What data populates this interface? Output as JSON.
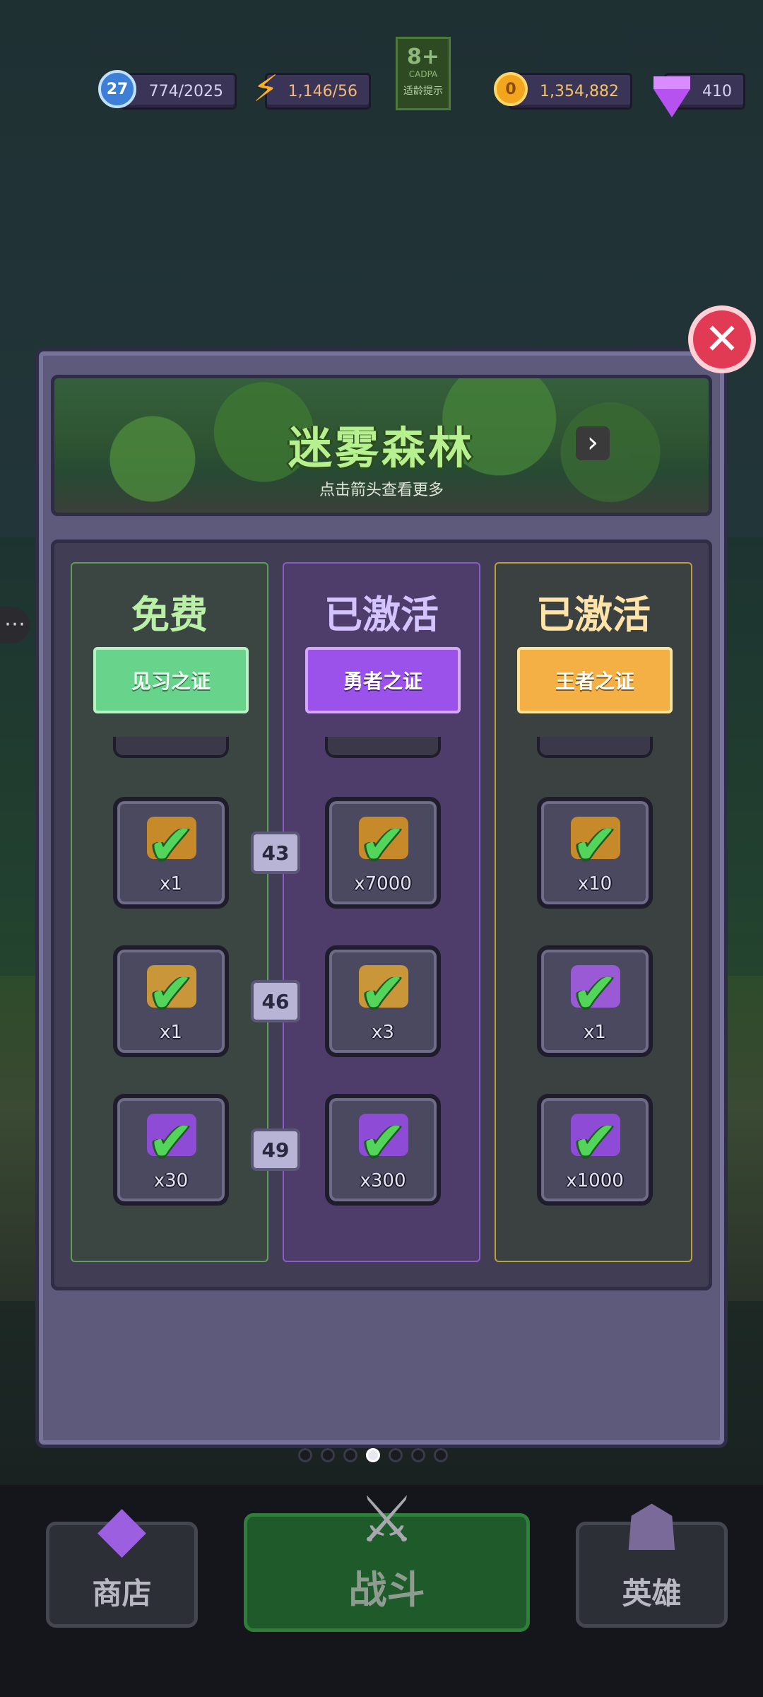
{
  "hud": {
    "level": "27",
    "exp": "774/2025",
    "energy": "1,146/56",
    "age_rating": {
      "number": "8+",
      "code": "CADPA",
      "label": "适龄提示"
    },
    "coins": "1,354,882",
    "gems": "410"
  },
  "banner": {
    "title": "迷雾森林",
    "subtitle": "点击箭头查看更多",
    "arrow": "›"
  },
  "close_button": "✕",
  "columns": [
    {
      "status": "免费",
      "ticket": "见习之证",
      "rewards": [
        {
          "item": "bread-icon",
          "qty": "x1",
          "claimed": true
        },
        {
          "item": "key-icon",
          "qty": "x1",
          "claimed": true
        },
        {
          "item": "purple-gem-icon",
          "qty": "x30",
          "claimed": true
        }
      ]
    },
    {
      "status": "已激活",
      "ticket": "勇者之证",
      "rewards": [
        {
          "item": "bread-icon",
          "qty": "x7000",
          "claimed": true
        },
        {
          "item": "key-icon",
          "qty": "x3",
          "claimed": true
        },
        {
          "item": "purple-gem-icon",
          "qty": "x300",
          "claimed": true
        }
      ]
    },
    {
      "status": "已激活",
      "ticket": "王者之证",
      "rewards": [
        {
          "item": "bread-icon",
          "qty": "x10",
          "claimed": true
        },
        {
          "item": "purple-key-icon",
          "qty": "x1",
          "claimed": true
        },
        {
          "item": "purple-gem-icon",
          "qty": "x1000",
          "claimed": true
        }
      ]
    }
  ],
  "levels": [
    "43",
    "46",
    "49"
  ],
  "pager": {
    "count": 7,
    "active_index": 3
  },
  "nav": {
    "shop": "商店",
    "battle": "战斗",
    "hero": "英雄"
  },
  "side_handle": "⋯",
  "colors": {
    "free_accent": "#67d38b",
    "hero_accent": "#9b52ea",
    "king_accent": "#f4b044",
    "check_green": "#53d45a",
    "close_red": "#e13a55"
  }
}
